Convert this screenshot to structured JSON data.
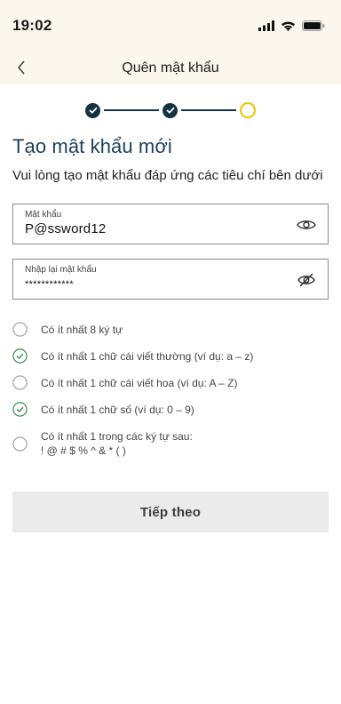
{
  "status_bar": {
    "time": "19:02"
  },
  "nav": {
    "title": "Quên mật khẩu"
  },
  "stepper": {
    "steps": 3,
    "completed": 2
  },
  "page": {
    "title": "Tạo mật khẩu mới",
    "subtitle": "Vui lòng tạo mật khẩu đáp ứng các tiêu chí bên dưới"
  },
  "fields": {
    "password": {
      "label": "Mật khẩu",
      "value": "P@ssword12"
    },
    "confirm": {
      "label": "Nhập lại mật khẩu",
      "value": "************"
    }
  },
  "criteria": [
    {
      "text": "Có ít nhất 8 ký tự",
      "met": false
    },
    {
      "text": "Có ít nhất 1 chữ cái viết thường (ví dụ: a – z)",
      "met": true
    },
    {
      "text": "Có ít nhất 1 chữ cái viết hoa (ví dụ: A – Z)",
      "met": false
    },
    {
      "text": "Có ít nhất 1 chữ số (ví dụ: 0 – 9)",
      "met": true
    },
    {
      "text": "Có ít nhất 1 trong các ký tự sau:",
      "text2": "! @ # $ % ^ & * ( )",
      "met": false
    }
  ],
  "button": {
    "label": "Tiếp theo"
  },
  "colors": {
    "accent_dark": "#14323f",
    "title": "#1a3f5c",
    "current_step": "#f2c200",
    "met": "#2e8b4a"
  }
}
